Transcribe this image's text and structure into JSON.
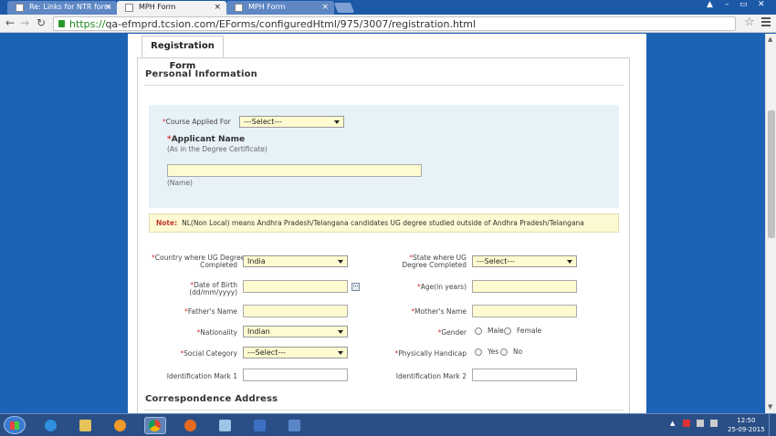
{
  "browser": {
    "tabs": [
      {
        "title": "Re: Links for NTR form",
        "active": false
      },
      {
        "title": "MPH Form",
        "active": true
      },
      {
        "title": "MPH Form",
        "active": false
      }
    ],
    "tab_close": "×",
    "url_scheme": "https://",
    "url_rest": "qa-efmprd.tcsion.com/EForms/configuredHtml/975/3007/registration.html",
    "back": "←",
    "forward": "→",
    "reload": "↻",
    "star": "☆",
    "win_minimize": "–",
    "win_maximize": "▭",
    "win_close": "✕",
    "win_user": "▲"
  },
  "form": {
    "tab_label": "Registration Form",
    "personal_info_title": "Personal Information",
    "course_label": "Course Applied For",
    "course_value": "---Select---",
    "applicant_name_label": "Applicant Name",
    "applicant_name_hint": "(As in the Degree Certificate)",
    "applicant_name_value": "",
    "name_caption": "(Name)",
    "note_label": "Note:",
    "note_text": "NL(Non Local) means Andhra Pradesh/Telangana candidates UG degree studied outside of Andhra Pradesh/Telangana",
    "country_label_1": "Country where UG Degree",
    "country_label_2": "Completed",
    "country_value": "India",
    "state_label_1": "State where UG",
    "state_label_2": "Degree Completed",
    "state_value": "---Select---",
    "dob_label_1": "Date of Birth",
    "dob_label_2": "(dd/mm/yyyy)",
    "dob_value": "",
    "age_label": "Age(in years)",
    "age_value": "",
    "father_label": "Father's Name",
    "father_value": "",
    "mother_label": "Mother's Name",
    "mother_value": "",
    "nationality_label": "Nationality",
    "nationality_value": "Indian",
    "gender_label": "Gender",
    "gender_options": [
      "Male",
      "Female"
    ],
    "social_label": "Social Category",
    "social_value": "---Select---",
    "handicap_label": "Physically Handicap",
    "handicap_options": [
      "Yes",
      "No"
    ],
    "idmark1_label": "Identification Mark 1",
    "idmark1_value": "",
    "idmark2_label": "Identification Mark 2",
    "idmark2_value": "",
    "correspondence_title": "Correspondence Address",
    "required_marker": "*"
  },
  "taskbar": {
    "time": "12:50",
    "date": "25-09-2015",
    "tray_up": "▲",
    "apps": [
      "ie-icon",
      "explorer-icon",
      "media-player-icon",
      "chrome-icon",
      "firefox-icon",
      "notepad-icon",
      "word-icon",
      "screen-icon"
    ]
  },
  "colors": {
    "page_background": "#1d63b5",
    "field_fill": "#fffbd0",
    "required": "#dd3333",
    "note_label": "#c0392b",
    "info_panel": "#e7f1f8"
  }
}
